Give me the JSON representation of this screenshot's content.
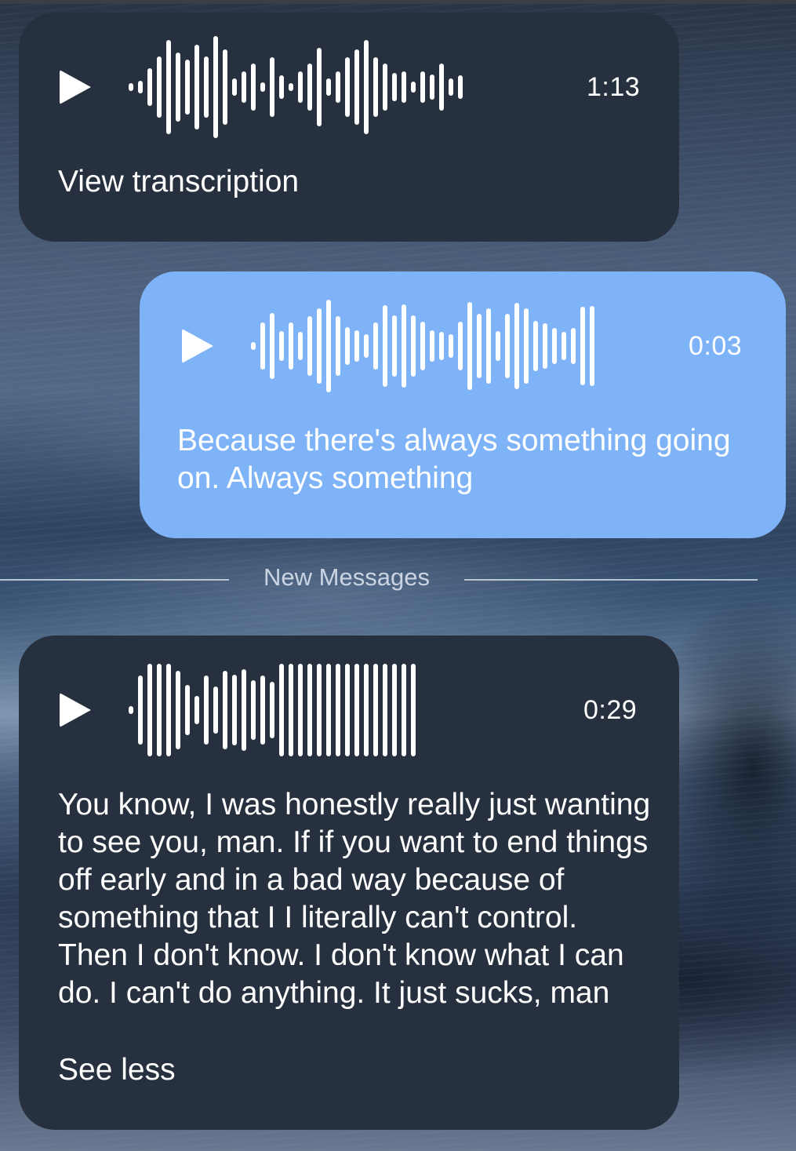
{
  "messages": [
    {
      "kind": "voice",
      "side": "incoming",
      "duration": "1:13",
      "link": "View transcription",
      "bars": [
        10,
        16,
        48,
        78,
        120,
        88,
        70,
        108,
        78,
        130,
        96,
        22,
        40,
        60,
        12,
        76,
        30,
        10,
        40,
        60,
        100,
        22,
        40,
        76,
        96,
        120,
        76,
        60,
        36,
        40,
        14,
        40,
        32,
        60,
        22,
        30
      ]
    },
    {
      "kind": "voice",
      "side": "outgoing",
      "duration": "0:03",
      "text": "Because there's always something going on. Always something",
      "bars": [
        10,
        60,
        84,
        38,
        60,
        36,
        76,
        96,
        118,
        76,
        48,
        40,
        30,
        60,
        104,
        78,
        106,
        78,
        62,
        40,
        36,
        30,
        62,
        112,
        82,
        96,
        38,
        82,
        110,
        96,
        64,
        58,
        46,
        36,
        46,
        100,
        102
      ]
    },
    {
      "kind": "voice",
      "side": "incoming",
      "duration": "0:29",
      "text": "You know, I was honestly really just wanting to see you, man. If if you want to end things off early and in a bad way because of something that I I literally can't control. Then I don't know. I don't know what I can do. I can't do anything. It just sucks, man",
      "link": "See less",
      "bars": [
        10,
        88,
        118,
        118,
        118,
        100,
        64,
        36,
        88,
        60,
        100,
        90,
        104,
        76,
        88,
        72,
        118,
        118,
        118,
        118,
        118,
        118,
        118,
        118,
        118,
        118,
        118,
        118,
        118,
        118,
        118
      ]
    }
  ],
  "divider": {
    "label": "New Messages"
  },
  "colors": {
    "incoming_bubble": "#27303e",
    "outgoing_bubble": "#7fb3f8",
    "text": "#ffffff"
  }
}
